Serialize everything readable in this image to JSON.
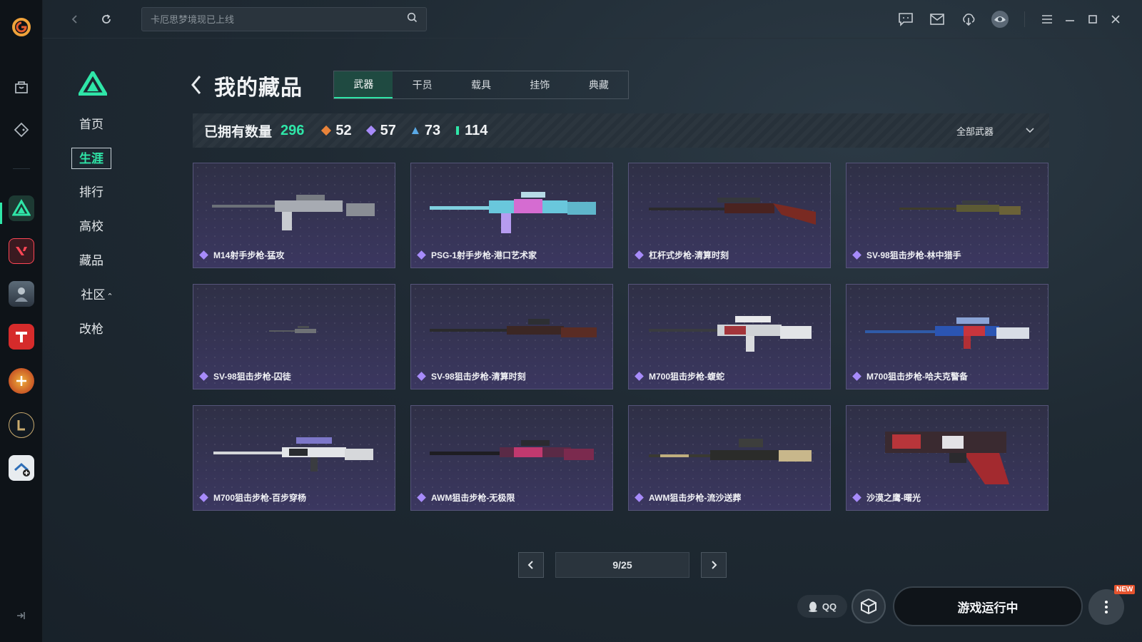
{
  "search": {
    "placeholder": "卡厄思梦境现已上线"
  },
  "sidebar": {
    "items": [
      {
        "label": "首页"
      },
      {
        "label": "生涯"
      },
      {
        "label": "排行"
      },
      {
        "label": "高校"
      },
      {
        "label": "藏品"
      },
      {
        "label": "社区",
        "suffix": "⌃"
      },
      {
        "label": "改枪"
      }
    ],
    "active_index": 1
  },
  "header": {
    "title": "我的藏品",
    "tabs": [
      {
        "label": "武器"
      },
      {
        "label": "干员"
      },
      {
        "label": "载具"
      },
      {
        "label": "挂饰"
      },
      {
        "label": "典藏"
      }
    ],
    "active_tab": 0
  },
  "stats": {
    "owned_label": "已拥有数量",
    "owned_total": "296",
    "tiers": [
      {
        "value": "52",
        "color": "#e8833a"
      },
      {
        "value": "57",
        "color": "#a78bfa"
      },
      {
        "value": "73",
        "color": "#5aa9e6"
      },
      {
        "value": "114",
        "color": "#2fe6a8"
      }
    ],
    "filter_label": "全部武器"
  },
  "items": [
    {
      "name": "M14射手步枪-猛攻",
      "icon": "rifle-silver-icon"
    },
    {
      "name": "PSG-1射手步枪-港口艺术家",
      "icon": "rifle-cyan-pink-icon"
    },
    {
      "name": "杠杆式步枪-清算时刻",
      "icon": "rifle-brown-icon"
    },
    {
      "name": "SV-98狙击步枪-林中猎手",
      "icon": "sniper-camo-icon"
    },
    {
      "name": "SV-98狙击步枪-囚徒",
      "icon": "sniper-small-icon"
    },
    {
      "name": "SV-98狙击步枪-清算时刻",
      "icon": "sniper-brown-icon"
    },
    {
      "name": "M700狙击步枪-蝮蛇",
      "icon": "sniper-white-red-icon"
    },
    {
      "name": "M700狙击步枪-哈夫克警备",
      "icon": "sniper-blue-red-icon"
    },
    {
      "name": "M700狙击步枪-百步穿杨",
      "icon": "sniper-white-icon"
    },
    {
      "name": "AWM狙击步枪-无极限",
      "icon": "sniper-pink-icon"
    },
    {
      "name": "AWM狙击步枪-流沙送葬",
      "icon": "sniper-sand-icon"
    },
    {
      "name": "沙漠之鹰-曙光",
      "icon": "pistol-red-icon"
    }
  ],
  "pagination": {
    "current": "9/25"
  },
  "footer": {
    "qq_label": "QQ",
    "run_label": "游戏运行中",
    "new_badge": "NEW"
  },
  "colors": {
    "accent": "#2fe6a8",
    "card_border": "#56557a",
    "rarity_purple": "#a78bfa"
  }
}
